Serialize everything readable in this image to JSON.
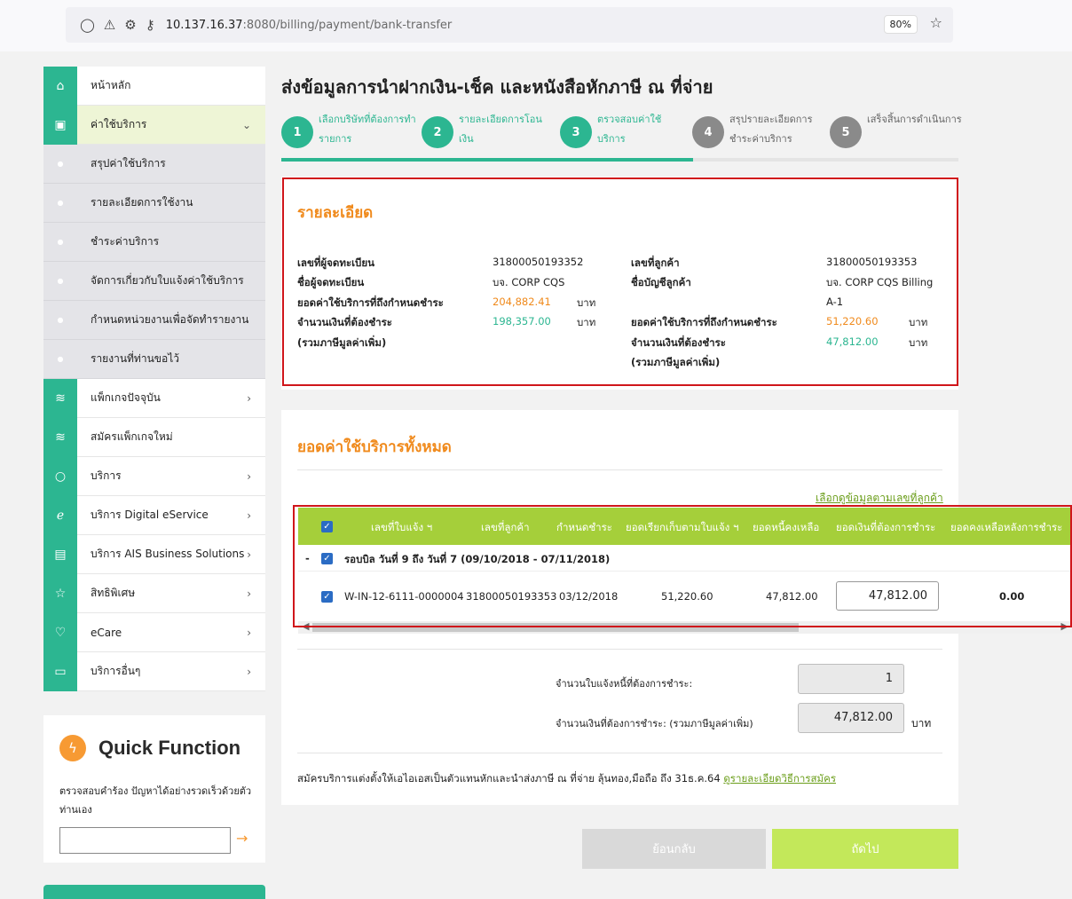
{
  "browser": {
    "url_host": "10.137.16.37",
    "url_path": ":8080/billing/payment/bank-transfer",
    "zoom": "80%"
  },
  "sidebar": {
    "items": [
      {
        "label": "หน้าหลัก",
        "icon": "home-icon"
      },
      {
        "label": "ค่าใช้บริการ",
        "icon": "bill-icon"
      },
      {
        "label": "แพ็กเกจปัจจุบัน",
        "icon": "layers-icon"
      },
      {
        "label": "สมัครแพ็กเกจใหม่",
        "icon": "layers-icon"
      },
      {
        "label": "บริการ",
        "icon": "circle-icon"
      },
      {
        "label": "บริการ Digital eService",
        "icon": "e-icon"
      },
      {
        "label": "บริการ AIS Business Solutions",
        "icon": "briefcase-icon"
      },
      {
        "label": "สิทธิพิเศษ",
        "icon": "star-icon"
      },
      {
        "label": "eCare",
        "icon": "heart-icon"
      },
      {
        "label": "บริการอื่นๆ",
        "icon": "monitor-icon"
      }
    ],
    "sub_items": [
      "สรุปค่าใช้บริการ",
      "รายละเอียดการใช้งาน",
      "ชำระค่าบริการ",
      "จัดการเกี่ยวกับใบแจ้งค่าใช้บริการ",
      "กำหนดหน่วยงานเพื่อจัดทำรายงาน",
      "รายงานที่ท่านขอไว้"
    ]
  },
  "quick_function": {
    "title": "Quick Function",
    "description": "ตรวจสอบคำร้อง ปัญหาได้อย่างรวดเร็วด้วยตัวท่านเอง"
  },
  "main": {
    "title": "ส่งข้อมูลการนำฝากเงิน-เช็ค และหนังสือหักภาษี ณ ที่จ่าย",
    "steps": [
      {
        "num": "1",
        "label": "เลือกบริษัทที่ต้องการทำรายการ",
        "state": "done"
      },
      {
        "num": "2",
        "label": "รายละเอียดการโอนเงิน",
        "state": "done"
      },
      {
        "num": "3",
        "label": "ตรวจสอบค่าใช้บริการ",
        "state": "done"
      },
      {
        "num": "4",
        "label": "สรุปรายละเอียดการชำระค่าบริการ",
        "state": "todo"
      },
      {
        "num": "5",
        "label": "เสร็จสิ้นการดำเนินการ",
        "state": "todo"
      }
    ]
  },
  "details": {
    "title": "รายละเอียด",
    "reg_no_label": "เลขที่ผู้จดทะเบียน",
    "reg_no": "31800050193352",
    "reg_name_label": "ชื่อผู้จดทะเบียน",
    "reg_name": "บจ. CORP CQS",
    "due_label": "ยอดค่าใช้บริการที่ถึงกำหนดชำระ",
    "due_value": "204,882.41",
    "pay_label": "จำนวนเงินที่ต้องชำระ",
    "pay_sub": "(รวมภาษีมูลค่าเพิ่ม)",
    "pay_value": "198,357.00",
    "unit": "บาท",
    "cust_no_label": "เลขที่ลูกค้า",
    "cust_no": "31800050193353",
    "acct_name_label": "ชื่อบัญชีลูกค้า",
    "acct_name_1": "บจ. CORP CQS Billing",
    "acct_name_2": "A-1",
    "cust_due_value": "51,220.60",
    "cust_pay_value": "47,812.00"
  },
  "total": {
    "title": "ยอดค่าใช้บริการทั้งหมด",
    "filter_link": "เลือกดูข้อมูลตามเลขที่ลูกค้า",
    "headers": [
      "เลขที่ใบแจ้ง ฯ",
      "เลขที่ลูกค้า",
      "กำหนดชำระ",
      "ยอดเรียกเก็บตามใบแจ้ง ฯ",
      "ยอดหนี้คงเหลือ",
      "ยอดเงินที่ต้องการชำระ",
      "ยอดคงเหลือหลังการชำระ"
    ],
    "group_label": "รอบบิล วันที่ 9 ถึง วันที่ 7 (09/10/2018 - 07/11/2018)",
    "row": {
      "invoice": "W-IN-12-6111-0000004",
      "customer": "31800050193353",
      "due_date": "03/12/2018",
      "billed": "51,220.60",
      "remaining": "47,812.00",
      "pay": "47,812.00",
      "after": "0.00"
    },
    "count_label": "จำนวนใบแจ้งหนี้ที่ต้องการชำระ:",
    "count_value": "1",
    "amount_label": "จำนวนเงินที่ต้องการชำระ: (รวมภาษีมูลค่าเพิ่ม)",
    "amount_value": "47,812.00",
    "unit": "บาท",
    "note_text": "สมัครบริการแต่งตั้งให้เอไอเอสเป็นตัวแทนหักและนำส่งภาษี ณ ที่จ่าย ลุ้นทอง,มือถือ ถึง 31ธ.ค.64",
    "note_link": "ดูรายละเอียดวิธีการสมัคร"
  },
  "buttons": {
    "back": "ย้อนกลับ",
    "next": "ถัดไป"
  }
}
